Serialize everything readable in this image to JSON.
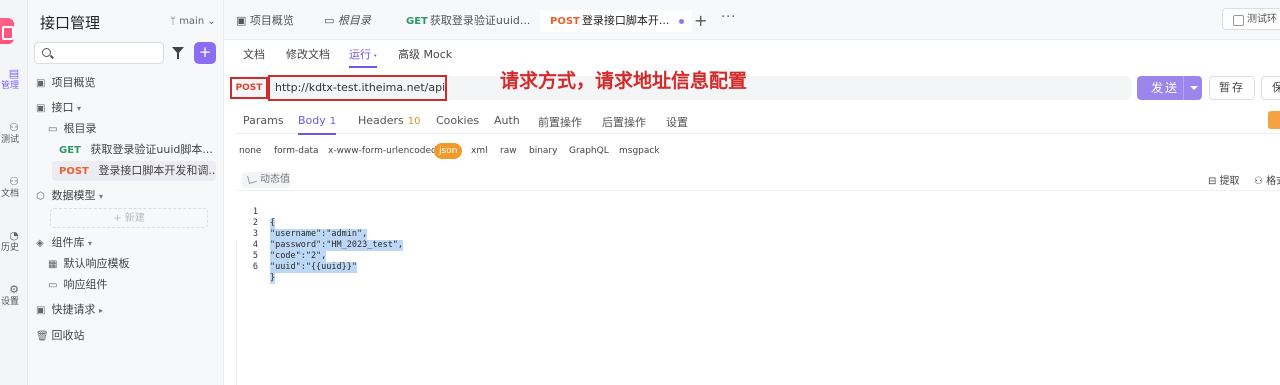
{
  "rail": {
    "items": [
      {
        "label": "管理",
        "active": true
      },
      {
        "label": "测试"
      },
      {
        "label": "文档"
      },
      {
        "label": "历史"
      },
      {
        "label": "设置"
      }
    ]
  },
  "sidebar": {
    "title": "接口管理",
    "branch": "main",
    "search": {
      "placeholder": ""
    },
    "tree": {
      "overview": "项目概览",
      "interfaces": "接口",
      "root_dir": "根目录",
      "api_get": {
        "method": "GET",
        "name": "获取登录验证uuid脚本..."
      },
      "api_post": {
        "method": "POST",
        "name": "登录接口脚本开发和调..."
      },
      "data_models": "数据模型",
      "new_label": "+ 新建",
      "components": "组件库",
      "default_response": "默认响应模板",
      "response_component": "响应组件",
      "quick_request": "快捷请求",
      "recycle_bin": "回收站"
    }
  },
  "topbar": {
    "tabs": [
      {
        "label": "项目概览"
      },
      {
        "label": "根目录"
      },
      {
        "method": "GET",
        "label": "获取登录验证uuid..."
      },
      {
        "method": "POST",
        "label": "登录接口脚本开..."
      }
    ],
    "env_label": "测试环"
  },
  "sub_tabs": [
    "文档",
    "修改文档",
    "运行",
    "高级 Mock"
  ],
  "request": {
    "method": "POST",
    "url": "http://kdtx-test.itheima.net/api/login",
    "annotation": "请求方式，请求地址信息配置",
    "send_label": "发送",
    "save_label": "暂存",
    "more_label": "保"
  },
  "req_tabs": [
    {
      "label": "Params"
    },
    {
      "label": "Body",
      "count": "1"
    },
    {
      "label": "Headers",
      "count": "10"
    },
    {
      "label": "Cookies"
    },
    {
      "label": "Auth"
    },
    {
      "label": "前置操作"
    },
    {
      "label": "后置操作"
    },
    {
      "label": "设置"
    }
  ],
  "body_types": [
    "none",
    "form-data",
    "x-www-form-urlencoded",
    "json",
    "xml",
    "raw",
    "binary",
    "GraphQL",
    "msgpack"
  ],
  "body_type_selected": "json",
  "toolbar": {
    "dynamic_label": "动态值",
    "extract_label": "提取",
    "format_label": "格式"
  },
  "editor": {
    "lines": [
      {
        "n": "1",
        "text": "{"
      },
      {
        "n": "2",
        "text": "\"username\":\"admin\","
      },
      {
        "n": "3",
        "text": "\"password\":\"HM_2023_test\","
      },
      {
        "n": "4",
        "text": "\"code\":\"2\","
      },
      {
        "n": "5",
        "text": "\"uuid\":\"{{uuid}}\""
      },
      {
        "n": "6",
        "text": "}"
      }
    ]
  },
  "colors": {
    "accent": "#6e59e6",
    "post": "#e8602c",
    "get": "#2b9a66",
    "highlight_box": "#cc2d2d",
    "annotation": "#d52a2a",
    "json_pill": "#f09a2a"
  }
}
